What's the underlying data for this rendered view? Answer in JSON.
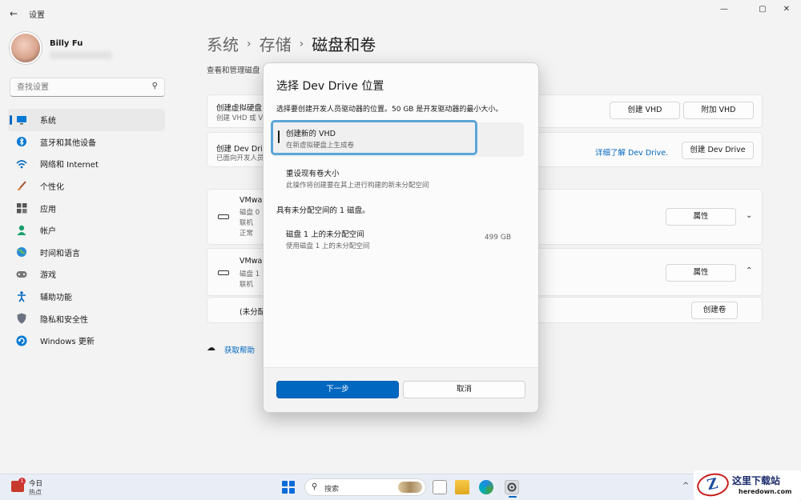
{
  "window": {
    "back": "←",
    "title": "设置",
    "controls": {
      "minimize": "—",
      "maximize": "▢",
      "close": "✕"
    }
  },
  "profile": {
    "name": "Billy Fu"
  },
  "sidebar": {
    "search_placeholder": "查找设置",
    "items": [
      {
        "label": "系统",
        "icon": "monitor-icon",
        "active": true
      },
      {
        "label": "蓝牙和其他设备",
        "icon": "bluetooth-icon"
      },
      {
        "label": "网络和 Internet",
        "icon": "wifi-icon"
      },
      {
        "label": "个性化",
        "icon": "brush-icon"
      },
      {
        "label": "应用",
        "icon": "apps-icon"
      },
      {
        "label": "帐户",
        "icon": "person-icon"
      },
      {
        "label": "时间和语言",
        "icon": "globe-icon"
      },
      {
        "label": "游戏",
        "icon": "gamepad-icon"
      },
      {
        "label": "辅助功能",
        "icon": "accessibility-icon"
      },
      {
        "label": "隐私和安全性",
        "icon": "shield-icon"
      },
      {
        "label": "Windows 更新",
        "icon": "update-icon"
      }
    ]
  },
  "breadcrumb": {
    "part1": "系统",
    "part2": "存储",
    "current": "磁盘和卷",
    "sep": "›"
  },
  "page_desc": "查看和管理磁盘",
  "cards": {
    "vhd": {
      "title": "创建虚拟硬盘",
      "sub": "创建 VHD 或 VHD",
      "btn1": "创建 VHD",
      "btn2": "附加 VHD"
    },
    "devdrive": {
      "title": "创建 Dev Driv",
      "sub": "已面向开发人员",
      "link": "详细了解 Dev Drive.",
      "btn": "创建 Dev Drive"
    },
    "disk0": {
      "name": "VMwa",
      "l1": "磁盘 0",
      "l2": "联机",
      "l3": "正常",
      "btn": "属性"
    },
    "disk1": {
      "name": "VMwa",
      "l1": "磁盘 1",
      "l2": "联机",
      "btn": "属性"
    },
    "unalloc": {
      "label": "(未分配",
      "btn": "创建卷"
    }
  },
  "help_link": "获取帮助",
  "dialog": {
    "title": "选择 Dev Drive 位置",
    "desc": "选择要创建开发人员驱动器的位置。50 GB 是开发驱动器的最小大小。",
    "options": [
      {
        "title": "创建新的 VHD",
        "sub": "在新虚拟硬盘上生成卷"
      },
      {
        "title": "重设现有卷大小",
        "sub": "此操作将创建要在其上进行构建的新未分配空间"
      }
    ],
    "section": "具有未分配空间的 1 磁盘。",
    "disk_option": {
      "title": "磁盘 1 上的未分配空间",
      "sub": "使用磁盘 1 上的未分配空间",
      "value": "499 GB"
    },
    "next": "下一步",
    "cancel": "取消"
  },
  "taskbar": {
    "weather_title": "今日",
    "weather_sub": "热点",
    "weather_badge": "1",
    "search_label": "搜索",
    "tray_chevron": "^"
  },
  "watermark": {
    "title": "这里下载站",
    "sub": "heredown.com"
  }
}
